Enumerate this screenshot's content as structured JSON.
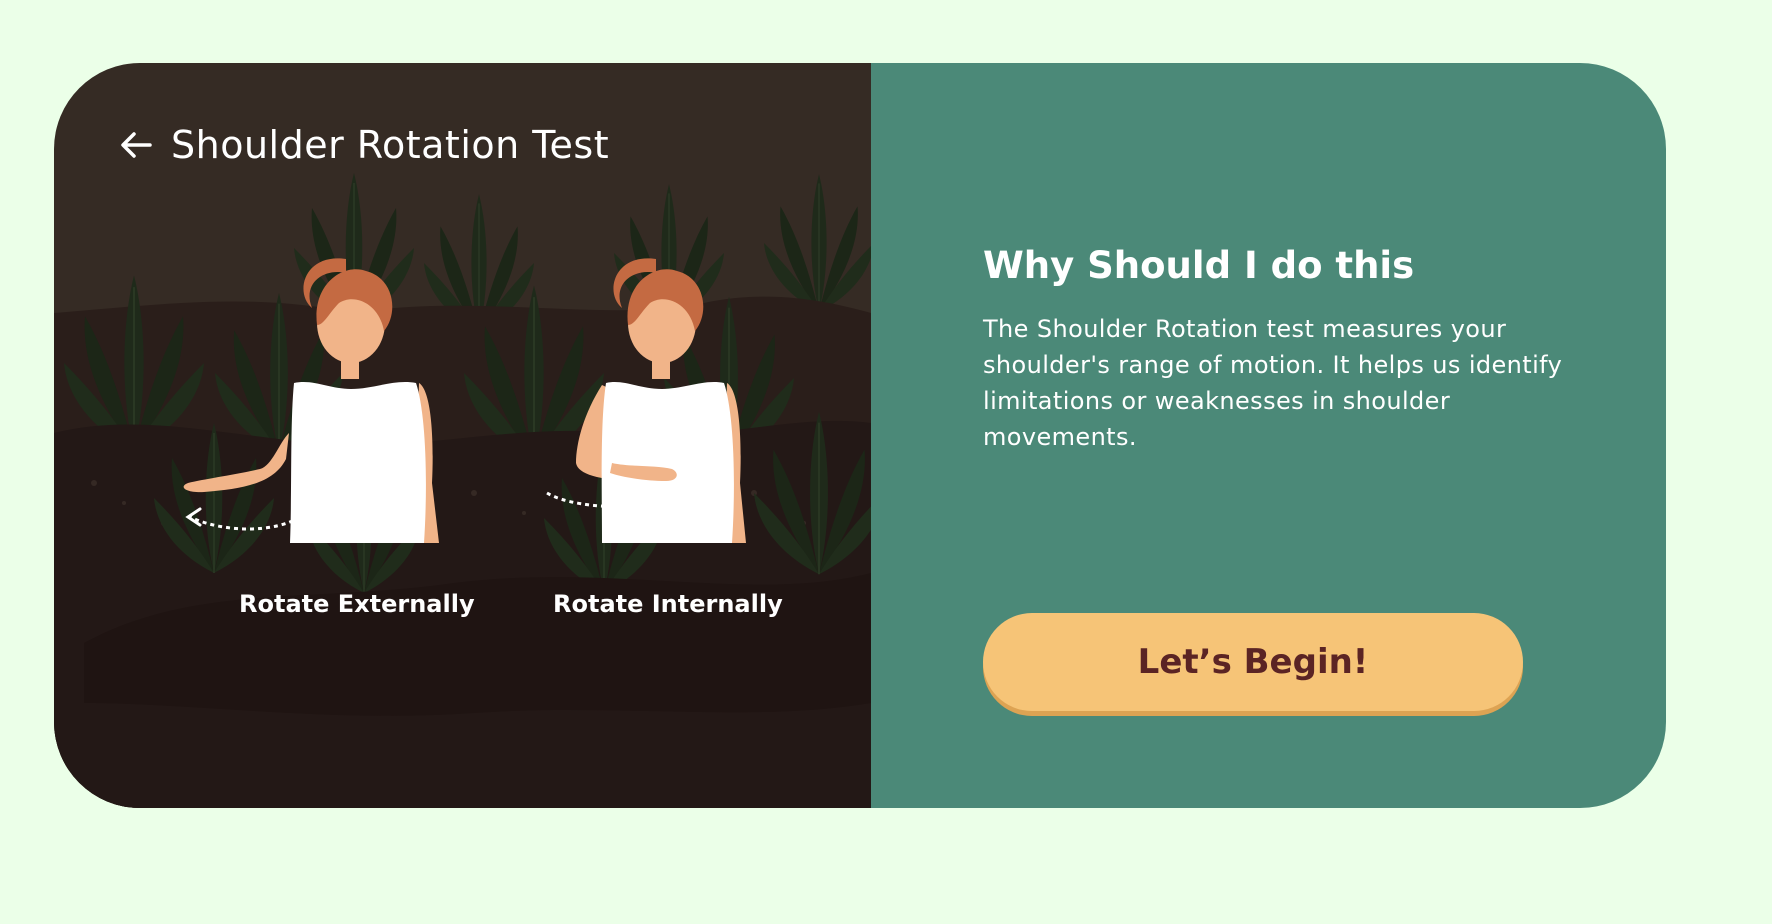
{
  "header": {
    "back_icon": "arrow-left-icon",
    "title": "Shoulder Rotation Test"
  },
  "illustration": {
    "figures": [
      {
        "label": "Rotate Externally",
        "direction_icon": "dotted-arrow-left-icon"
      },
      {
        "label": "Rotate Internally",
        "direction_icon": "dotted-arrow-right-icon"
      }
    ]
  },
  "info": {
    "heading": "Why Should I do this",
    "description": "The Shoulder Rotation test measures your shoulder's range of motion. It helps us identify limitations or weaknesses in shoulder movements."
  },
  "actions": {
    "begin_label": "Let’s Begin!"
  },
  "colors": {
    "page_background": "#ebffe8",
    "left_panel": "#352b24",
    "right_panel": "#4b8978",
    "button": "#f6c477",
    "button_text": "#5b2424"
  }
}
